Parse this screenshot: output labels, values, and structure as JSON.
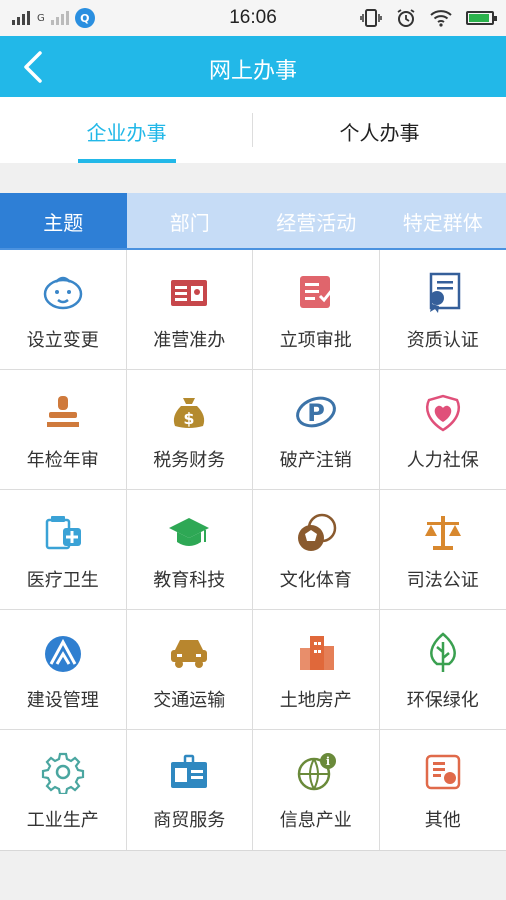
{
  "status_bar": {
    "carrier_letter": "G",
    "time": "16:06",
    "qq_glyph": "Q",
    "battery_level_percent": 90
  },
  "header": {
    "title": "网上办事",
    "back_icon": "chevron-left-icon"
  },
  "top_tabs": [
    {
      "label": "企业办事",
      "active": true
    },
    {
      "label": "个人办事",
      "active": false
    }
  ],
  "sub_tabs": [
    {
      "label": "主题",
      "active": true
    },
    {
      "label": "部门",
      "active": false
    },
    {
      "label": "经营活动",
      "active": false
    },
    {
      "label": "特定群体",
      "active": false
    }
  ],
  "categories": [
    {
      "label": "设立变更",
      "icon": "baby-face-icon",
      "color": "#3a86c8"
    },
    {
      "label": "准营准办",
      "icon": "license-card-icon",
      "color": "#c7474b"
    },
    {
      "label": "立项审批",
      "icon": "document-check-icon",
      "color": "#e0656c"
    },
    {
      "label": "资质认证",
      "icon": "certificate-icon",
      "color": "#355f9a"
    },
    {
      "label": "年检年审",
      "icon": "stamp-icon",
      "color": "#cf7a3c"
    },
    {
      "label": "税务财务",
      "icon": "money-bag-icon",
      "color": "#b48a2e"
    },
    {
      "label": "破产注销",
      "icon": "bankruptcy-icon",
      "color": "#3c73a8"
    },
    {
      "label": "人力社保",
      "icon": "heart-shield-icon",
      "color": "#e0507a"
    },
    {
      "label": "医疗卫生",
      "icon": "medical-icon",
      "color": "#3aa2d6"
    },
    {
      "label": "教育科技",
      "icon": "graduation-cap-icon",
      "color": "#2ea855"
    },
    {
      "label": "文化体育",
      "icon": "sports-balls-icon",
      "color": "#8a5a2e"
    },
    {
      "label": "司法公证",
      "icon": "scales-icon",
      "color": "#d8882e"
    },
    {
      "label": "建设管理",
      "icon": "construction-icon",
      "color": "#2f7fd0"
    },
    {
      "label": "交通运输",
      "icon": "car-icon",
      "color": "#b8862e"
    },
    {
      "label": "土地房产",
      "icon": "buildings-icon",
      "color": "#e0683a"
    },
    {
      "label": "环保绿化",
      "icon": "leaf-tree-icon",
      "color": "#3aa050"
    },
    {
      "label": "工业生产",
      "icon": "gear-icon",
      "color": "#4aa6a0"
    },
    {
      "label": "商贸服务",
      "icon": "id-badge-icon",
      "color": "#2f88c0"
    },
    {
      "label": "信息产业",
      "icon": "globe-info-icon",
      "color": "#6a8a3a"
    },
    {
      "label": "其他",
      "icon": "other-box-icon",
      "color": "#e06a4a"
    }
  ]
}
